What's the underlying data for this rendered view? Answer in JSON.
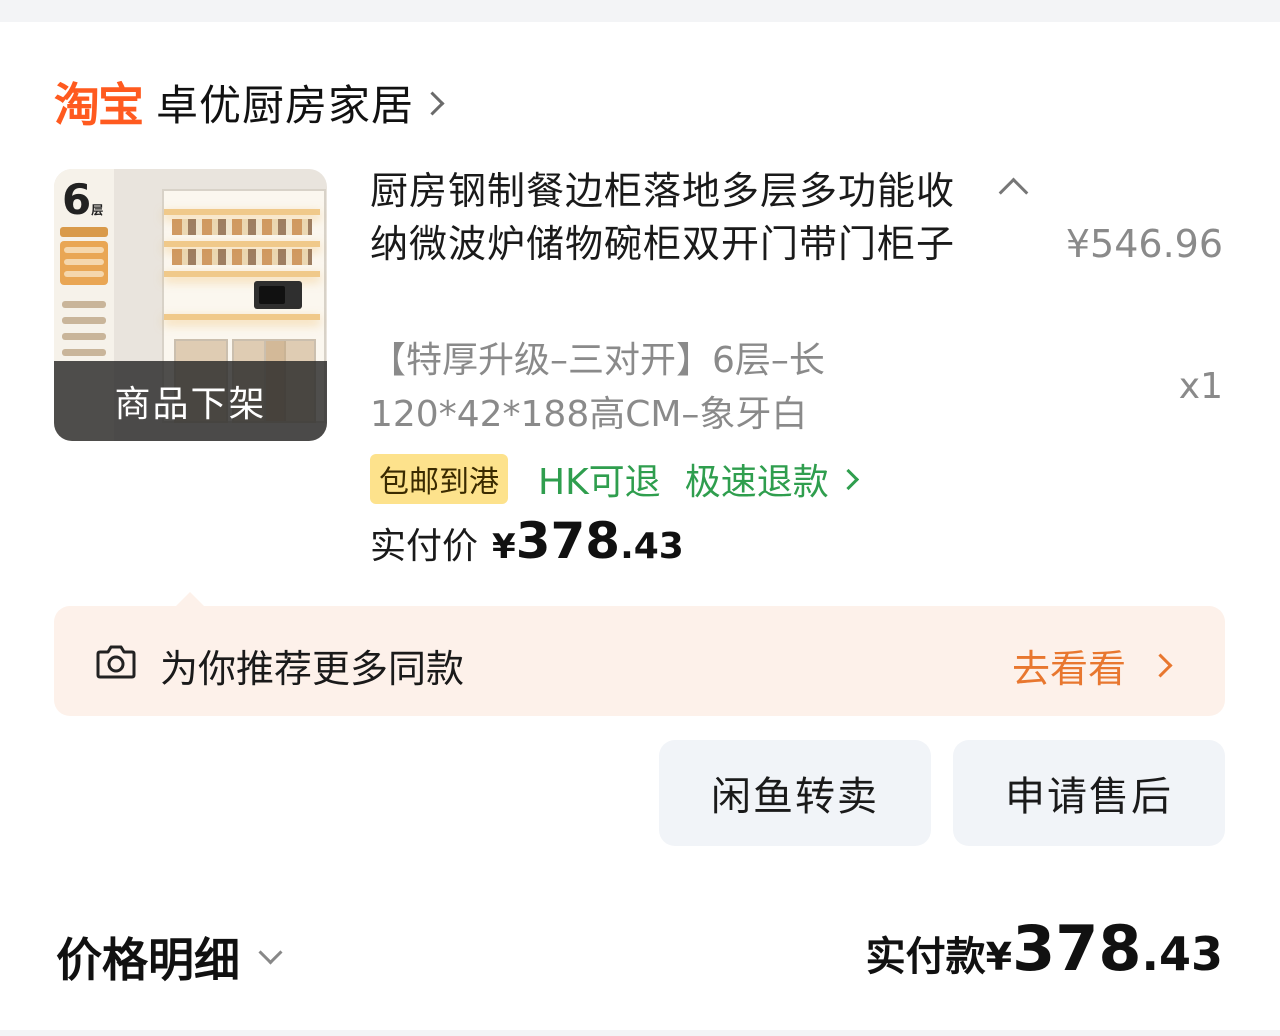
{
  "shop": {
    "platform_logo": "淘宝",
    "name": "卓优厨房家居"
  },
  "product": {
    "title": "厨房钢制餐边柜落地多层多功能收纳微波炉储物碗柜双开门带门柜子",
    "thumb_badge": "6",
    "thumb_badge_unit": "层",
    "thumb_overlay": "商品下架",
    "original_price": "¥546.96",
    "sku": "【特厚升级–三对开】6层–长120*42*188高CM–象牙白",
    "quantity": "x1",
    "tags": {
      "shipping": "包邮到港",
      "return": "HK可退",
      "refund": "极速退款"
    },
    "paid": {
      "label": "实付价",
      "currency": "¥",
      "integer": "378",
      "decimal": ".43"
    }
  },
  "recommend": {
    "icon": "camera-icon",
    "text": "为你推荐更多同款",
    "action": "去看看"
  },
  "buttons": {
    "resell": "闲鱼转卖",
    "aftersale": "申请售后"
  },
  "footer": {
    "price_detail": "价格明细",
    "total_label": "实付款",
    "total_currency": "¥",
    "total_integer": "378",
    "total_decimal": ".43"
  },
  "colors": {
    "taobao_orange": "#ff5a1f",
    "green": "#2f9e4e",
    "reco_bg": "#fdf1ea",
    "reco_action": "#e8772f",
    "tag_yellow": "#fde28c"
  }
}
